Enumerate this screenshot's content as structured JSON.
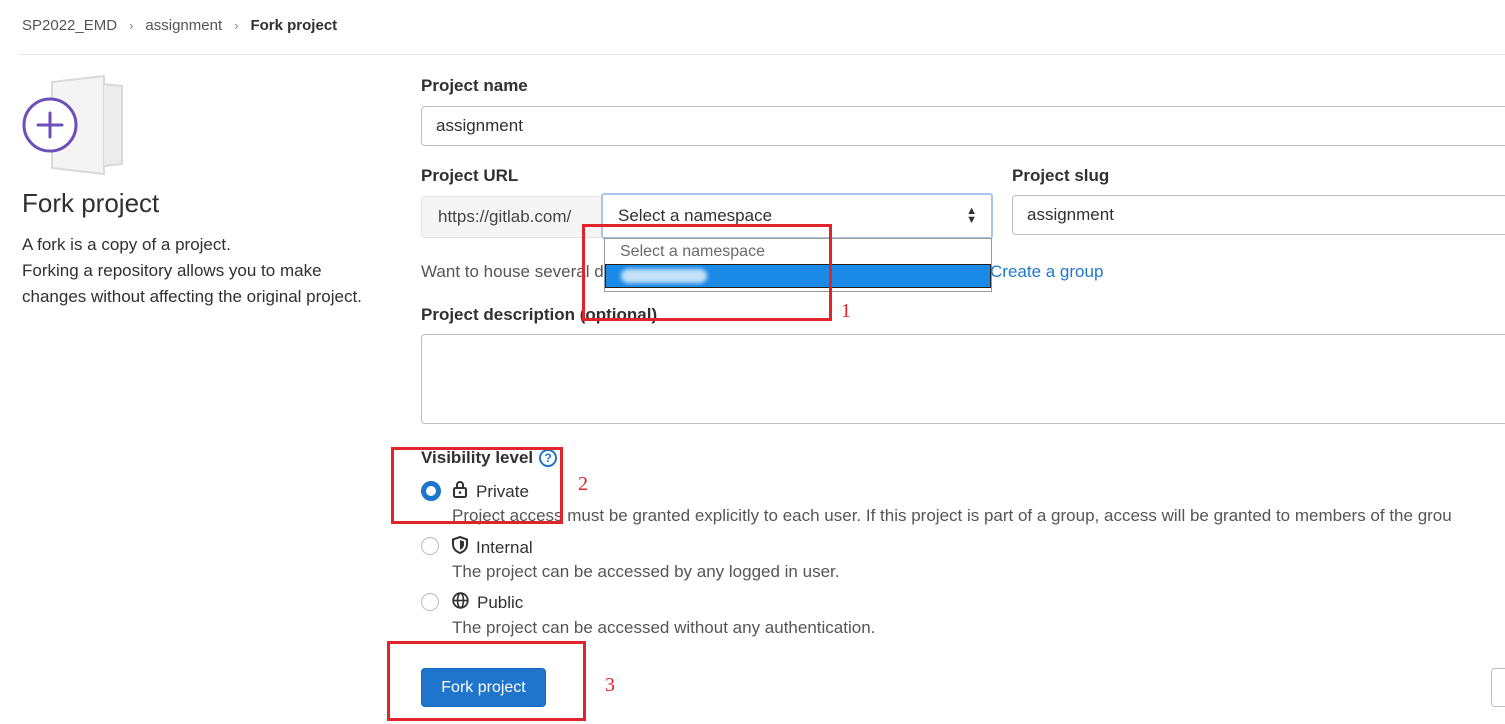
{
  "breadcrumb": {
    "items": [
      "SP2022_EMD",
      "assignment"
    ],
    "current": "Fork project",
    "separator": "›"
  },
  "sidebar": {
    "title": "Fork project",
    "description_lines": [
      "A fork is a copy of a project.",
      "Forking a repository allows you to make changes without affecting the original project."
    ]
  },
  "form": {
    "project_name_label": "Project name",
    "project_name_value": "assignment",
    "project_url_label": "Project URL",
    "url_prefix": "https://gitlab.com/",
    "namespace_select_value": "Select a namespace",
    "namespace_options": [
      "Select a namespace",
      ""
    ],
    "project_slug_label": "Project slug",
    "project_slug_value": "assignment",
    "helper_text": "Want to house several d",
    "create_group_link": "Create a group",
    "description_label": "Project description (optional)",
    "description_value": ""
  },
  "visibility": {
    "label": "Visibility level",
    "options": [
      {
        "label": "Private",
        "icon": "lock-icon",
        "checked": true,
        "help": "Project access must be granted explicitly to each user. If this project is part of a group, access will be granted to members of the grou"
      },
      {
        "label": "Internal",
        "icon": "shield-icon",
        "checked": false,
        "help": "The project can be accessed by any logged in user."
      },
      {
        "label": "Public",
        "icon": "globe-icon",
        "checked": false,
        "help": "The project can be accessed without any authentication."
      }
    ]
  },
  "actions": {
    "fork_button": "Fork project"
  },
  "annotations": [
    "1",
    "2",
    "3"
  ],
  "colors": {
    "primary": "#1f75cb",
    "annotation_red": "#e0242a",
    "illustration_purple": "#6b4fbb",
    "link": "#1f78d1"
  }
}
